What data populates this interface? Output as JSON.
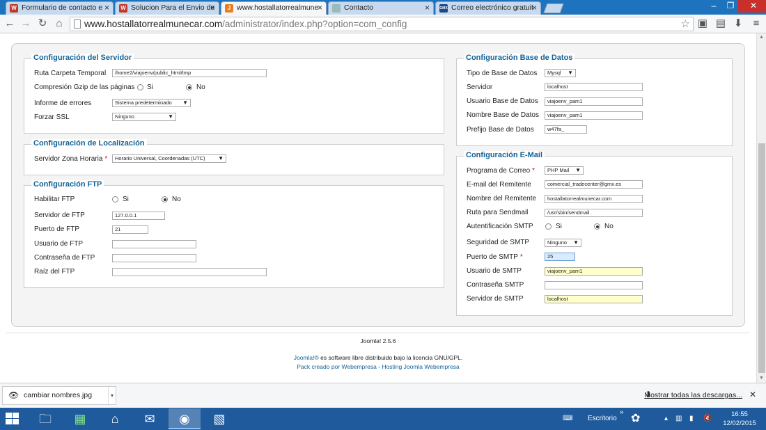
{
  "tabs": [
    {
      "label": "Formulario de contacto e",
      "favicon": "W",
      "favicon_color": "#c0392b"
    },
    {
      "label": "Solucion Para el Envio de",
      "favicon": "W",
      "favicon_color": "#c0392b"
    },
    {
      "label": "www.hostallatorrealmune",
      "favicon": "J",
      "favicon_color": "#e67e22"
    },
    {
      "label": "Contacto",
      "favicon": "",
      "favicon_color": "#9bb"
    },
    {
      "label": "Correo electrónico gratuit",
      "favicon": "GMX",
      "favicon_color": "#1c4b8c"
    }
  ],
  "window": {
    "minimize": "‒",
    "maximize": "❐",
    "close": "✕"
  },
  "address": {
    "host": "www.hostallatorrealmunecar.com",
    "path": "/administrator/index.php?option=com_config"
  },
  "servidor": {
    "legend": "Configuración del Servidor",
    "ruta_label": "Ruta Carpeta Temporal",
    "ruta_value": "/home2/viajoenv/public_html/tmp",
    "gzip_label": "Compresión Gzip de las páginas",
    "si": "Si",
    "no": "No",
    "informe_label": "Informe de errores",
    "informe_value": "Sistema predeterminado",
    "ssl_label": "Forzar SSL",
    "ssl_value": "Ninguno"
  },
  "localizacion": {
    "legend": "Configuración de Localización",
    "zona_label": "Servidor Zona Horaria",
    "zona_value": "Horario Universal, Coordenadas (UTC)"
  },
  "ftp": {
    "legend": "Configuración FTP",
    "habilitar_label": "Habilitar FTP",
    "si": "Si",
    "no": "No",
    "servidor_label": "Servidor de FTP",
    "servidor_value": "127.0.0.1",
    "puerto_label": "Puerto de FTP",
    "puerto_value": "21",
    "usuario_label": "Usuario de FTP",
    "usuario_value": "",
    "contrasena_label": "Contraseña de FTP",
    "contrasena_value": "",
    "raiz_label": "Raíz del FTP",
    "raiz_value": ""
  },
  "basedatos": {
    "legend": "Configuración Base de Datos",
    "tipo_label": "Tipo de Base de Datos",
    "tipo_value": "Mysql",
    "servidor_label": "Servidor",
    "servidor_value": "localhost",
    "usuario_label": "Usuario Base de Datos",
    "usuario_value": "viajoenv_pam1",
    "nombre_label": "Nombre Base de Datos",
    "nombre_value": "viajoenv_pam1",
    "prefijo_label": "Prefijo Base de Datos",
    "prefijo_value": "w47fa_"
  },
  "email": {
    "legend": "Configuración E-Mail",
    "programa_label": "Programa de Correo",
    "programa_value": "PHP Mail",
    "remitente_email_label": "E-mail del Remitente",
    "remitente_email_value": "comercial_tradecenter@gmx.es",
    "remitente_nombre_label": "Nombre del Remitente",
    "remitente_nombre_value": "hostallatorrealmunecar.com",
    "sendmail_label": "Ruta para Sendmail",
    "sendmail_value": "/usr/sbin/sendmail",
    "auth_label": "Autentificación SMTP",
    "si": "Si",
    "no": "No",
    "seguridad_label": "Seguridad de SMTP",
    "seguridad_value": "Ninguno",
    "puerto_label": "Puerto de SMTP",
    "puerto_value": "25",
    "usuario_label": "Usuario de SMTP",
    "usuario_value": "viajoenv_pam1",
    "contrasena_label": "Contraseña SMTP",
    "contrasena_value": "",
    "servidor_label": "Servidor de SMTP",
    "servidor_value": "localhost"
  },
  "footer": {
    "version": "Joomla! 2.5.6",
    "license_link": "Joomla!®",
    "license_text": " es software libre distribuido bajo la licencia GNU/GPL.",
    "pack_link": "Pack creado por Webempresa",
    "separator": " - ",
    "hosting_link": "Hosting Joomla Webempresa"
  },
  "downloads": {
    "item": "cambiar nombres.jpg",
    "show_all": "Mostrar todas las descargas..."
  },
  "taskbar": {
    "desktop_label": "Escritorio",
    "time": "16:55",
    "date": "12/02/2015"
  }
}
